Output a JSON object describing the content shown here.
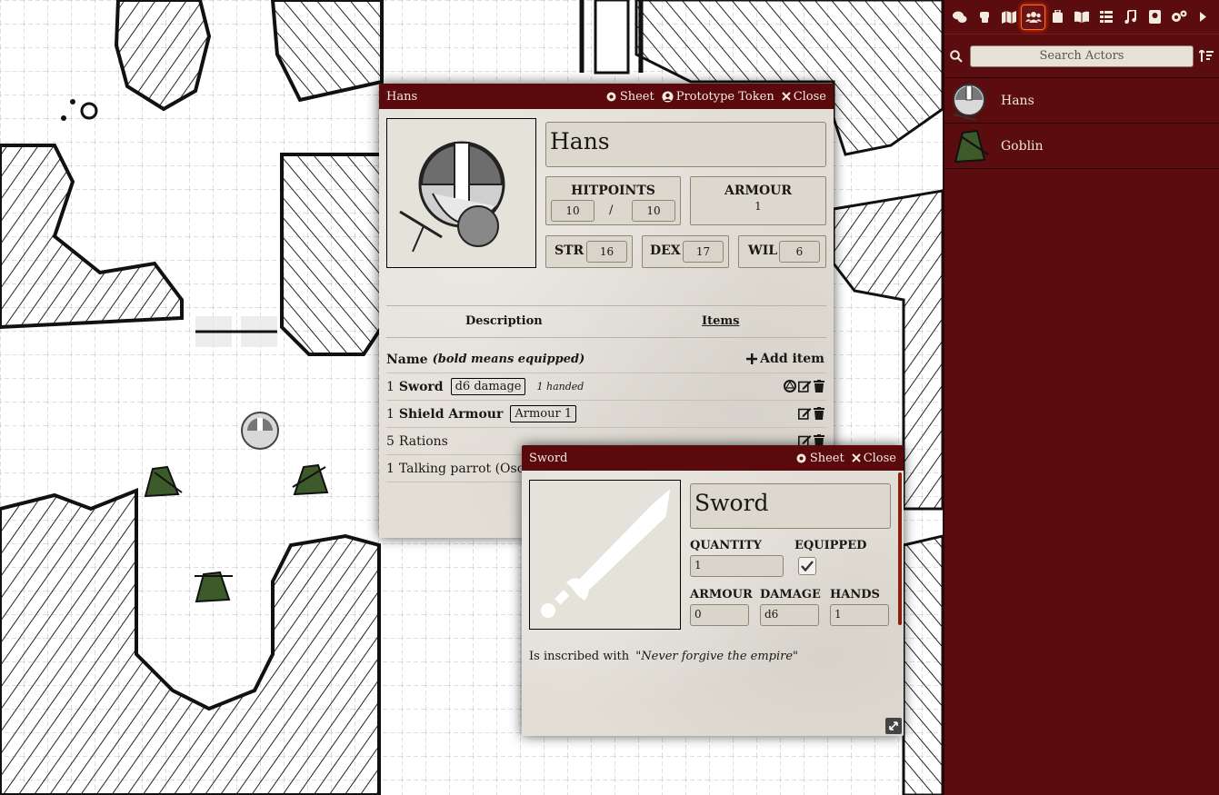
{
  "sidebar": {
    "tabs": [
      {
        "icon": "chat-icon"
      },
      {
        "icon": "combat-fist-icon"
      },
      {
        "icon": "map-icon"
      },
      {
        "icon": "users-icon",
        "active": true
      },
      {
        "icon": "suitcase-icon"
      },
      {
        "icon": "book-open-icon"
      },
      {
        "icon": "list-table-icon"
      },
      {
        "icon": "music-icon"
      },
      {
        "icon": "compendium-icon"
      },
      {
        "icon": "settings-gears-icon"
      },
      {
        "icon": "caret-right-icon"
      }
    ],
    "search_placeholder": "Search Actors",
    "actors": [
      {
        "name": "Hans"
      },
      {
        "name": "Goblin"
      }
    ]
  },
  "actor_sheet": {
    "title": "Hans",
    "header_buttons": {
      "sheet": "Sheet",
      "token": "Prototype Token",
      "close": "Close"
    },
    "name": "Hans",
    "hitpoints": {
      "label": "HITPOINTS",
      "value": "10",
      "sep": "/",
      "max": "10"
    },
    "armour": {
      "label": "ARMOUR",
      "value": "1"
    },
    "attributes": [
      {
        "label": "STR",
        "value": "16"
      },
      {
        "label": "DEX",
        "value": "17"
      },
      {
        "label": "WIL",
        "value": "6"
      }
    ],
    "tabs": {
      "description": "Description",
      "items": "Items"
    },
    "items_header": {
      "name": "Name",
      "hint": "(bold means equipped)",
      "add": "Add item"
    },
    "items": [
      {
        "qty": "1",
        "name": "Sword",
        "equipped": true,
        "tag": "d6 damage",
        "extra": "1 handed"
      },
      {
        "qty": "1",
        "name": "Shield Armour",
        "equipped": true,
        "tag": "Armour 1",
        "extra": ""
      },
      {
        "qty": "5",
        "name": "Rations",
        "equipped": false,
        "tag": "",
        "extra": ""
      },
      {
        "qty": "1",
        "name": "Talking parrot (Oscar)",
        "equipped": false,
        "tag": "",
        "extra": ""
      }
    ]
  },
  "item_sheet": {
    "title": "Sword",
    "header_buttons": {
      "sheet": "Sheet",
      "close": "Close"
    },
    "name": "Sword",
    "quantity": {
      "label": "QUANTITY",
      "value": "1"
    },
    "equipped": {
      "label": "EQUIPPED",
      "checked": true
    },
    "armour": {
      "label": "ARMOUR",
      "value": "0"
    },
    "damage": {
      "label": "DAMAGE",
      "value": "d6"
    },
    "hands": {
      "label": "HANDS",
      "value": "1"
    },
    "description_prefix": "Is inscribed with",
    "description_quote": "\"Never forgive the empire\""
  },
  "colors": {
    "header": "#5a0a0c",
    "sidebar": "#5a0c0e",
    "parchment": "#e2ded6",
    "active_tab_glow": "#ff4000"
  }
}
